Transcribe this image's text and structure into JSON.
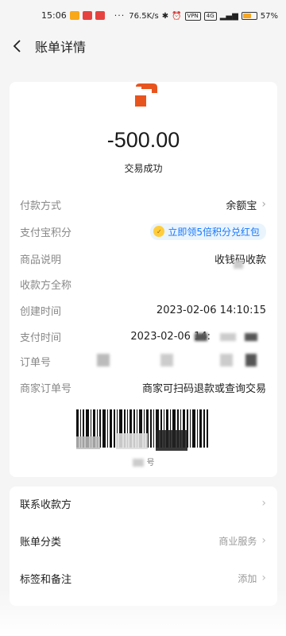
{
  "status_bar": {
    "time": "15:06",
    "dots": "···",
    "net_speed": "76.5K/s",
    "vpn": "VPN",
    "signal_label": "4G",
    "battery_percent": "57%",
    "battery_level": 0.57
  },
  "nav": {
    "title": "账单详情"
  },
  "summary": {
    "amount": "-500.00",
    "status": "交易成功",
    "brand_color": "#e8541e"
  },
  "details": {
    "payment_method": {
      "label": "付款方式",
      "value": "余额宝"
    },
    "points": {
      "label": "支付宝积分",
      "promo": "立即领5倍积分兑红包"
    },
    "goods": {
      "label": "商品说明",
      "value": "收钱码收款"
    },
    "payee": {
      "label": "收款方全称"
    },
    "created": {
      "label": "创建时间",
      "value": "2023-02-06 14:10:15"
    },
    "paid": {
      "label": "支付时间",
      "value": "2023-02-06 14:"
    },
    "order_no": {
      "label": "订单号"
    },
    "merchant_order": {
      "label": "商家订单号",
      "value": "商家可扫码退款或查询交易"
    },
    "barcode_caption": "号"
  },
  "links": [
    {
      "label": "联系收款方",
      "value": ""
    },
    {
      "label": "账单分类",
      "value": "商业服务"
    },
    {
      "label": "标签和备注",
      "value": "添加"
    }
  ]
}
